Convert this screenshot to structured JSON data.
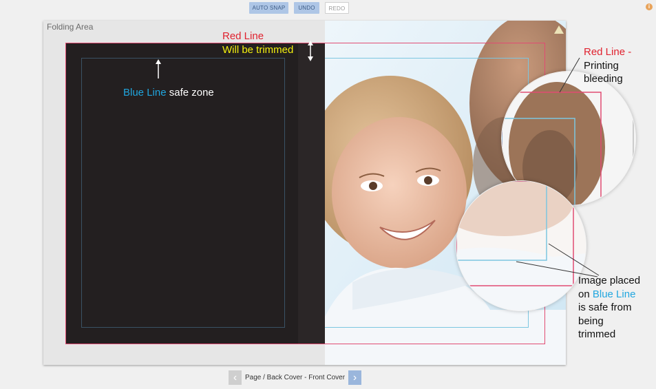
{
  "toolbar": {
    "auto_snap": "AUTO SNAP",
    "undo": "UNDO",
    "redo": "REDO"
  },
  "info_icon": "i",
  "editor": {
    "folding_area_label": "Folding Area"
  },
  "annotations": {
    "red_line_title": "Red Line",
    "will_be_trimmed": "Will be trimmed",
    "blue_line": "Blue Line",
    "safe_zone": " safe zone",
    "bleed_red_line": "Red Line -",
    "bleed_printing": "Printing",
    "bleed_bleeding": "bleeding",
    "safe_image_placed": "Image placed",
    "safe_on": "on ",
    "safe_blue_line": "Blue Line",
    "safe_is_safe_from": "is safe from",
    "safe_being": "being",
    "safe_trimmed": "trimmed"
  },
  "pager": {
    "label": "Page / Back Cover - Front Cover",
    "prev_icon": "chevron-left-icon",
    "next_icon": "chevron-right-icon"
  },
  "colors": {
    "red_line": "#e0212e",
    "blue_line": "#20a6df",
    "trim_text": "#f4f10e",
    "toolbar_active": "#aec6e6"
  }
}
